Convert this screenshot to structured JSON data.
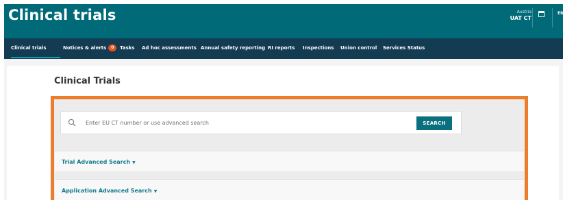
{
  "header": {
    "title": "Clinical trials",
    "org_country": "Austria",
    "org_name": "UAT CT",
    "calendar_icon": "calendar-icon",
    "lang": "EN"
  },
  "nav": {
    "items": [
      {
        "label": "Clinical trials",
        "active": true
      },
      {
        "label": "Notices & alerts",
        "badge": "0"
      },
      {
        "label": "Tasks"
      },
      {
        "label": "Ad hoc assessments"
      },
      {
        "label": "Annual safety reporting"
      },
      {
        "label": "RI reports"
      },
      {
        "label": "Inspections"
      },
      {
        "label": "Union control"
      },
      {
        "label": "Services Status"
      }
    ]
  },
  "main": {
    "heading": "Clinical Trials",
    "search": {
      "placeholder": "Enter EU CT number or use advanced search",
      "value": "",
      "button_label": "SEARCH"
    },
    "sections": [
      {
        "label": "Trial Advanced Search"
      },
      {
        "label": "Application Advanced Search"
      }
    ]
  },
  "colors": {
    "header_bg": "#006a79",
    "nav_bg": "#133c52",
    "accent": "#0a6f7f",
    "highlight_border": "#ee7d2b",
    "badge": "#e8521f"
  }
}
